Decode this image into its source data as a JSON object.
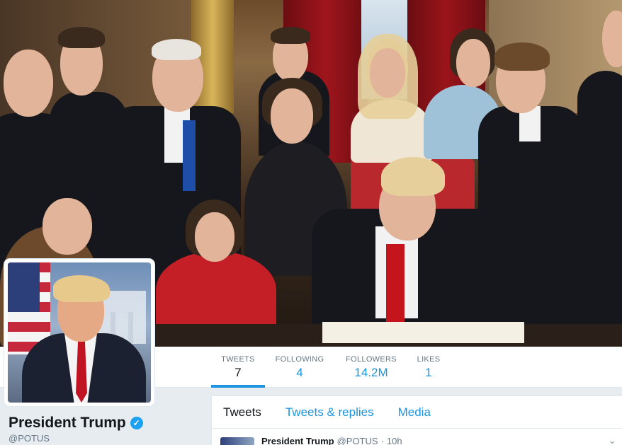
{
  "profile": {
    "name": "President Trump",
    "handle": "@POTUS",
    "verified_icon": "verified-badge-icon"
  },
  "stats": [
    {
      "label": "TWEETS",
      "value": "7",
      "active": true
    },
    {
      "label": "FOLLOWING",
      "value": "4",
      "active": false
    },
    {
      "label": "FOLLOWERS",
      "value": "14.2M",
      "active": false
    },
    {
      "label": "LIKES",
      "value": "1",
      "active": false
    }
  ],
  "timeline": {
    "tabs": [
      {
        "label": "Tweets",
        "active": true
      },
      {
        "label": "Tweets & replies",
        "active": false
      },
      {
        "label": "Media",
        "active": false
      }
    ],
    "tweet": {
      "name": "President Trump",
      "handle": "@POTUS",
      "separator": "·",
      "time": "10h",
      "menu_icon": "chevron-down-icon"
    }
  },
  "colors": {
    "accent": "#1b95e0",
    "verified": "#1da1f2",
    "text": "#14171a",
    "muted": "#657786",
    "background": "#e6ecf0"
  }
}
